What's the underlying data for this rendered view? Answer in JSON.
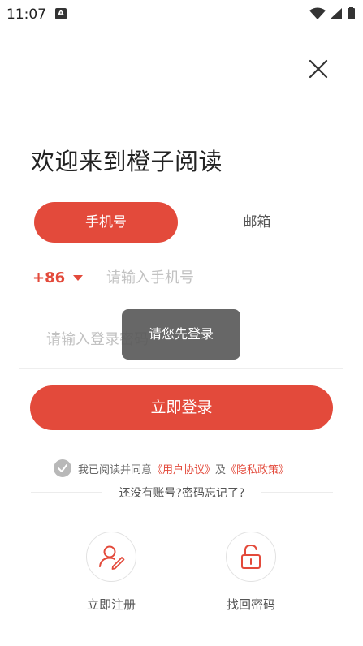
{
  "status_bar": {
    "time": "11:07",
    "app_icon_letter": "A",
    "icons": [
      "wifi-icon",
      "signal-icon",
      "battery-icon"
    ]
  },
  "header": {
    "close_icon": "close-icon",
    "title": "欢迎来到橙子阅读"
  },
  "tabs": [
    {
      "label": "手机号",
      "active": true
    },
    {
      "label": "邮箱",
      "active": false
    }
  ],
  "form": {
    "country_code": "+86",
    "phone_placeholder": "请输入手机号",
    "password_placeholder": "请输入登录密码",
    "login_button": "立即登录"
  },
  "toast": {
    "message": "请您先登录"
  },
  "agreement": {
    "checked": true,
    "prefix": "我已阅读并同意",
    "user_agreement": "《用户协议》",
    "and": "及",
    "privacy_policy": "《隐私政策》"
  },
  "help": {
    "text": "还没有账号?密码忘记了?"
  },
  "actions": [
    {
      "label": "立即注册",
      "icon": "user-edit-icon"
    },
    {
      "label": "找回密码",
      "icon": "unlock-icon"
    }
  ],
  "colors": {
    "accent": "#e34a3b",
    "toast_bg": "#5a5a5a",
    "placeholder": "#c2c2c2"
  }
}
